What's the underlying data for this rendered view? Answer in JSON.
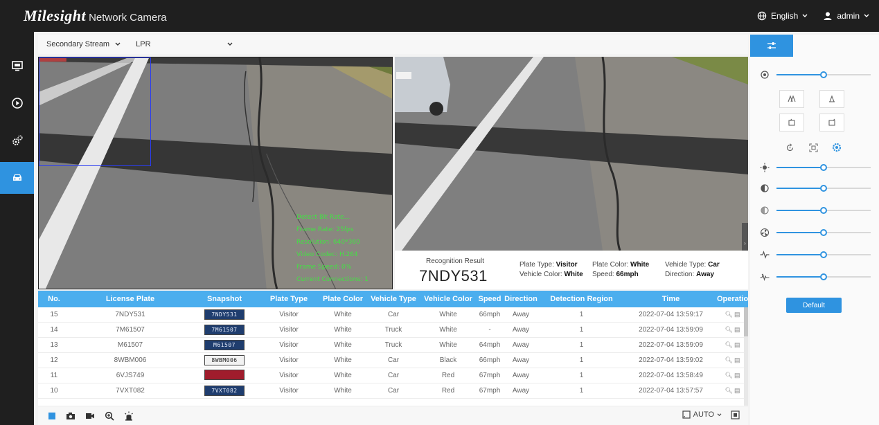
{
  "app": {
    "brand": "Milesight",
    "product": "Network Camera"
  },
  "header": {
    "language": "English",
    "user": "admin"
  },
  "nav": [
    {
      "name": "live-view",
      "icon": "monitor-icon"
    },
    {
      "name": "playback",
      "icon": "play-circle-icon"
    },
    {
      "name": "settings",
      "icon": "gears-icon"
    },
    {
      "name": "vehicle",
      "icon": "car-icon"
    }
  ],
  "stream": {
    "stream_select": "Secondary Stream",
    "mode_select": "LPR"
  },
  "osd_lines": [
    "Detect Bit Rate...",
    "Frame Rate: 25fps",
    "Resolution: 640*360",
    "Video Codec: H.264",
    "Frame Speed: 0%",
    "Current Connections: 1"
  ],
  "result": {
    "title": "Recognition Result",
    "plate": "7NDY531",
    "plate_type_label": "Plate Type:",
    "plate_type": "Visitor",
    "plate_color_label": "Plate Color:",
    "plate_color": "White",
    "vehicle_type_label": "Vehicle Type:",
    "vehicle_type": "Car",
    "vehicle_color_label": "Vehicle Color:",
    "vehicle_color": "White",
    "speed_label": "Speed:",
    "speed": "66mph",
    "direction_label": "Direction:",
    "direction": "Away"
  },
  "table": {
    "headers": [
      "No.",
      "License Plate",
      "Snapshot",
      "Plate Type",
      "Plate Color",
      "Vehicle Type",
      "Vehicle Color",
      "Speed",
      "Direction",
      "Detection Region",
      "Time",
      "Operation"
    ],
    "rows": [
      {
        "no": "15",
        "plate": "7NDY531",
        "snap": "7NDY531",
        "snap_style": "blue",
        "ptype": "Visitor",
        "pcolor": "White",
        "vtype": "Car",
        "vcolor": "White",
        "speed": "66mph",
        "dir": "Away",
        "region": "1",
        "time": "2022-07-04 13:59:17"
      },
      {
        "no": "14",
        "plate": "7M61507",
        "snap": "7M61507",
        "snap_style": "blue",
        "ptype": "Visitor",
        "pcolor": "White",
        "vtype": "Truck",
        "vcolor": "White",
        "speed": "-",
        "dir": "Away",
        "region": "1",
        "time": "2022-07-04 13:59:09"
      },
      {
        "no": "13",
        "plate": "M61507",
        "snap": "M61507",
        "snap_style": "blue",
        "ptype": "Visitor",
        "pcolor": "White",
        "vtype": "Truck",
        "vcolor": "White",
        "speed": "64mph",
        "dir": "Away",
        "region": "1",
        "time": "2022-07-04 13:59:09"
      },
      {
        "no": "12",
        "plate": "8WBM006",
        "snap": "8WBM006",
        "snap_style": "light",
        "ptype": "Visitor",
        "pcolor": "White",
        "vtype": "Car",
        "vcolor": "Black",
        "speed": "66mph",
        "dir": "Away",
        "region": "1",
        "time": "2022-07-04 13:59:02"
      },
      {
        "no": "11",
        "plate": "6VJS749",
        "snap": "",
        "snap_style": "red",
        "ptype": "Visitor",
        "pcolor": "White",
        "vtype": "Car",
        "vcolor": "Red",
        "speed": "67mph",
        "dir": "Away",
        "region": "1",
        "time": "2022-07-04 13:58:49"
      },
      {
        "no": "10",
        "plate": "7VXT082",
        "snap": "7VXT082",
        "snap_style": "blue",
        "ptype": "Visitor",
        "pcolor": "White",
        "vtype": "Car",
        "vcolor": "Red",
        "speed": "67mph",
        "dir": "Away",
        "region": "1",
        "time": "2022-07-04 13:57:57"
      }
    ]
  },
  "toolbar": {
    "zoom_mode": "AUTO"
  },
  "panel": {
    "default_label": "Default",
    "sliders": [
      {
        "icon": "iris-icon",
        "value": 0.5
      },
      {
        "icon": "brightness-icon",
        "value": 0.5
      },
      {
        "icon": "contrast-icon",
        "value": 0.5
      },
      {
        "icon": "saturation-icon",
        "value": 0.5
      },
      {
        "icon": "sharpness-icon",
        "value": 0.5
      },
      {
        "icon": "noise-reduction-icon",
        "value": 0.5
      },
      {
        "icon": "wdr-icon",
        "value": 0.5
      }
    ]
  },
  "colors": {
    "accent": "#2f93e0",
    "header": "#1f1f1f",
    "table_header": "#4baeee",
    "osd": "#44e044"
  }
}
